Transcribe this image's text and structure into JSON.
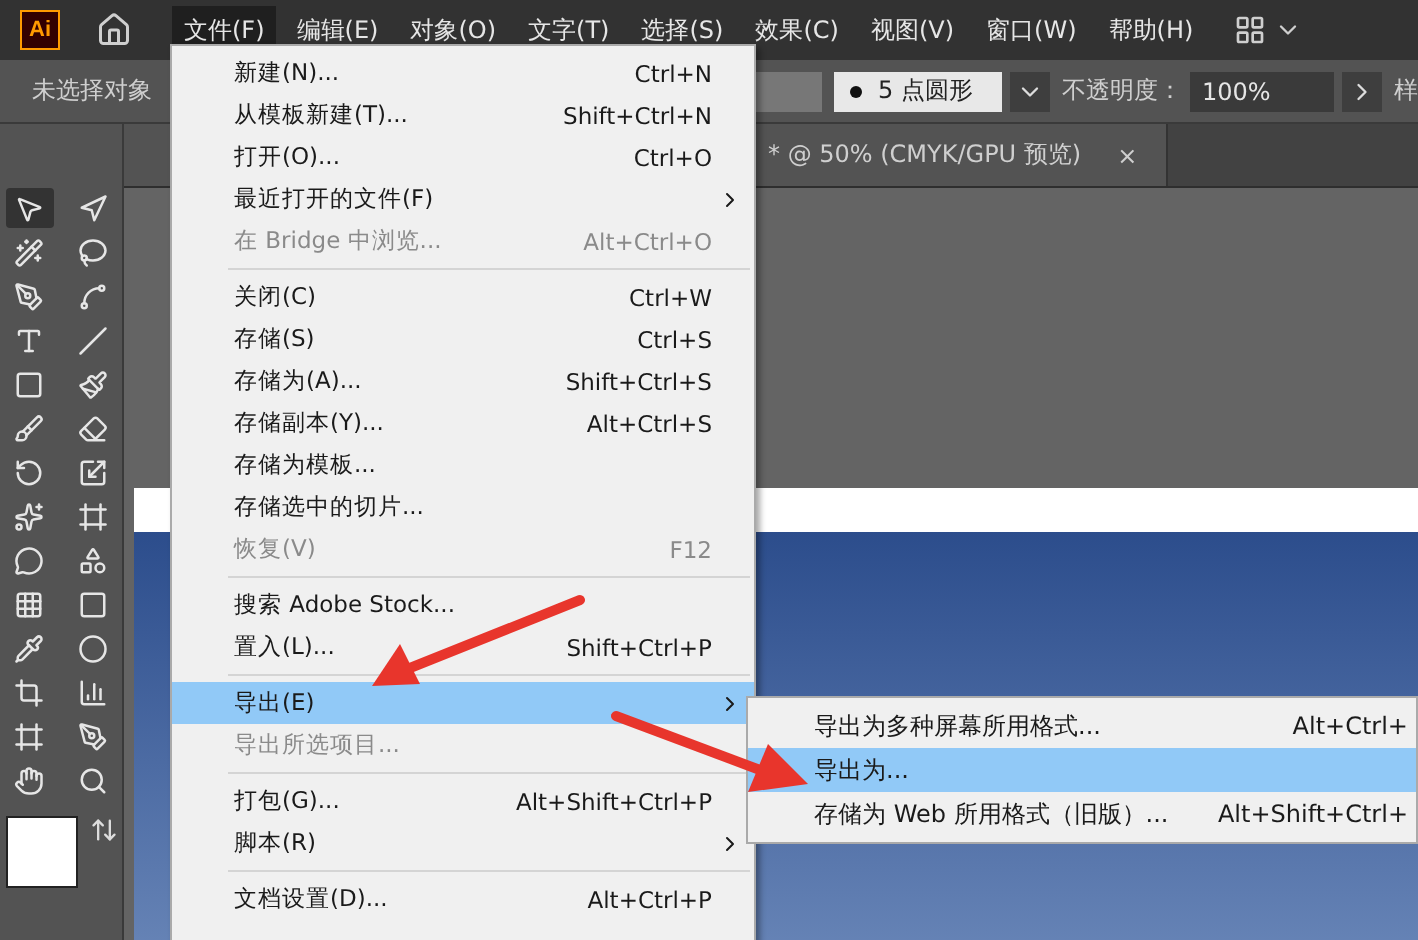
{
  "menubar": {
    "logo": "Ai",
    "menus": [
      {
        "label": "文件(F)",
        "selected": true
      },
      {
        "label": "编辑(E)",
        "selected": false
      },
      {
        "label": "对象(O)",
        "selected": false
      },
      {
        "label": "文字(T)",
        "selected": false
      },
      {
        "label": "选择(S)",
        "selected": false
      },
      {
        "label": "效果(C)",
        "selected": false
      },
      {
        "label": "视图(V)",
        "selected": false
      },
      {
        "label": "窗口(W)",
        "selected": false
      },
      {
        "label": "帮助(H)",
        "selected": false
      }
    ]
  },
  "control_bar": {
    "selection": "未选择对象",
    "brush": "5 点圆形",
    "opacity_label": "不透明度：",
    "opacity": "100%",
    "style_label": "样"
  },
  "document_tab": {
    "title": "* @ 50% (CMYK/GPU 预览)",
    "close": "×"
  },
  "file_menu": [
    {
      "kind": "item",
      "label": "新建(N)...",
      "shortcut": "Ctrl+N",
      "submenu": false,
      "disabled": false,
      "selected": false
    },
    {
      "kind": "item",
      "label": "从模板新建(T)...",
      "shortcut": "Shift+Ctrl+N",
      "submenu": false,
      "disabled": false,
      "selected": false
    },
    {
      "kind": "item",
      "label": "打开(O)...",
      "shortcut": "Ctrl+O",
      "submenu": false,
      "disabled": false,
      "selected": false
    },
    {
      "kind": "item",
      "label": "最近打开的文件(F)",
      "submenu": true,
      "disabled": false,
      "selected": false
    },
    {
      "kind": "item",
      "label": "在 Bridge 中浏览...",
      "shortcut": "Alt+Ctrl+O",
      "submenu": false,
      "disabled": true,
      "selected": false
    },
    {
      "kind": "separator"
    },
    {
      "kind": "item",
      "label": "关闭(C)",
      "shortcut": "Ctrl+W",
      "submenu": false,
      "disabled": false,
      "selected": false
    },
    {
      "kind": "item",
      "label": "存储(S)",
      "shortcut": "Ctrl+S",
      "submenu": false,
      "disabled": false,
      "selected": false
    },
    {
      "kind": "item",
      "label": "存储为(A)...",
      "shortcut": "Shift+Ctrl+S",
      "submenu": false,
      "disabled": false,
      "selected": false
    },
    {
      "kind": "item",
      "label": "存储副本(Y)...",
      "shortcut": "Alt+Ctrl+S",
      "submenu": false,
      "disabled": false,
      "selected": false
    },
    {
      "kind": "item",
      "label": "存储为模板...",
      "submenu": false,
      "disabled": false,
      "selected": false
    },
    {
      "kind": "item",
      "label": "存储选中的切片...",
      "submenu": false,
      "disabled": false,
      "selected": false
    },
    {
      "kind": "item",
      "label": "恢复(V)",
      "shortcut": "F12",
      "submenu": false,
      "disabled": true,
      "selected": false
    },
    {
      "kind": "separator"
    },
    {
      "kind": "item",
      "label": "搜索 Adobe Stock...",
      "submenu": false,
      "disabled": false,
      "selected": false
    },
    {
      "kind": "item",
      "label": "置入(L)...",
      "shortcut": "Shift+Ctrl+P",
      "submenu": false,
      "disabled": false,
      "selected": false
    },
    {
      "kind": "separator"
    },
    {
      "kind": "item",
      "label": "导出(E)",
      "submenu": true,
      "disabled": false,
      "selected": true
    },
    {
      "kind": "item",
      "label": "导出所选项目...",
      "submenu": false,
      "disabled": true,
      "selected": false
    },
    {
      "kind": "separator"
    },
    {
      "kind": "item",
      "label": "打包(G)...",
      "shortcut": "Alt+Shift+Ctrl+P",
      "submenu": false,
      "disabled": false,
      "selected": false
    },
    {
      "kind": "item",
      "label": "脚本(R)",
      "submenu": true,
      "disabled": false,
      "selected": false
    },
    {
      "kind": "separator"
    },
    {
      "kind": "item",
      "label": "文档设置(D)...",
      "shortcut": "Alt+Ctrl+P",
      "submenu": false,
      "disabled": false,
      "selected": false
    }
  ],
  "export_submenu": [
    {
      "label": "导出为多种屏幕所用格式...",
      "shortcut": "Alt+Ctrl+",
      "selected": false
    },
    {
      "label": "导出为...",
      "selected": true
    },
    {
      "label": "存储为 Web 所用格式（旧版）...",
      "shortcut": "Alt+Shift+Ctrl+",
      "selected": false
    }
  ]
}
